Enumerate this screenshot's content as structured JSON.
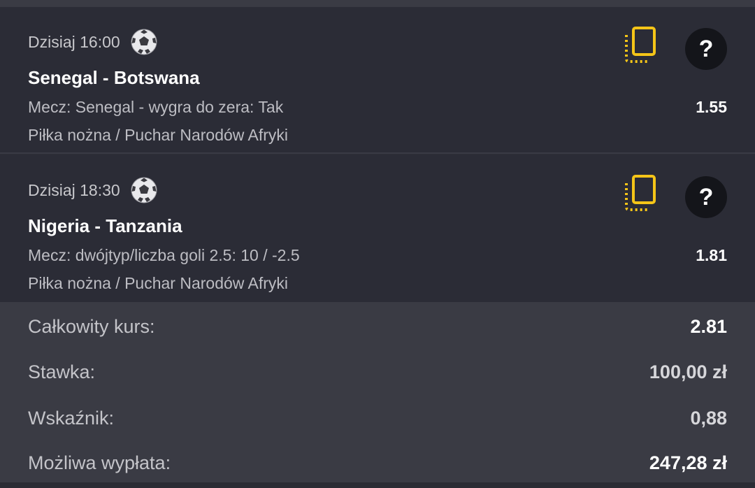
{
  "bets": [
    {
      "time": "Dzisiaj 16:00",
      "sport_icon": "soccer-ball-icon",
      "match": "Senegal - Botswana",
      "market": "Mecz: Senegal - wygra do zera: Tak",
      "odds": "1.55",
      "league": "Piłka nożna / Puchar Narodów Afryki"
    },
    {
      "time": "Dzisiaj 18:30",
      "sport_icon": "soccer-ball-icon",
      "match": "Nigeria - Tanzania",
      "market": "Mecz: dwójtyp/liczba goli 2.5: 10 / -2.5",
      "odds": "1.81",
      "league": "Piłka nożna / Puchar Narodów Afryki"
    }
  ],
  "help_label": "?",
  "summary": {
    "total_odds_label": "Całkowity kurs:",
    "total_odds_value": "2.81",
    "stake_label": "Stawka:",
    "stake_value": "100,00 zł",
    "indicator_label": "Wskaźnik:",
    "indicator_value": "0,88",
    "payout_label": "Możliwa wypłata:",
    "payout_value": "247,28 zł"
  },
  "colors": {
    "accent": "#f5c518",
    "background": "#2b2c36",
    "summary_background": "#3a3b44"
  }
}
